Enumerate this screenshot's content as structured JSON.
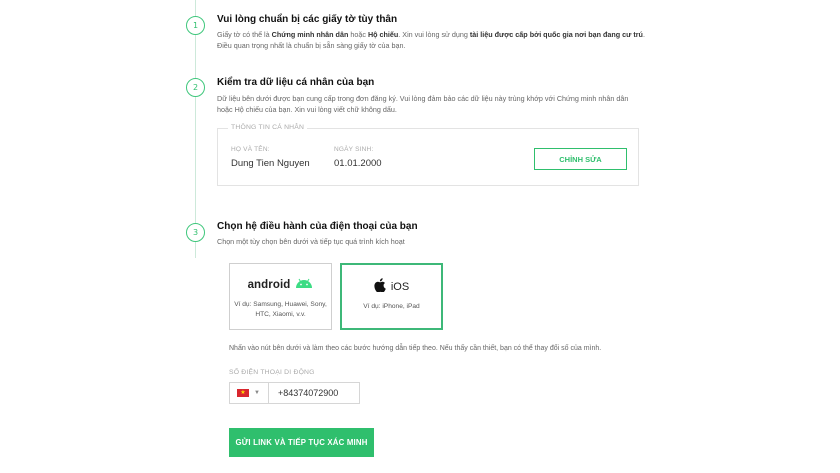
{
  "steps": [
    {
      "number": "1",
      "title": "Vui lòng chuẩn bị các giấy tờ tùy thân",
      "desc_parts": {
        "a": "Giấy tờ có thể là ",
        "b": "Chứng minh nhân dân",
        "c": " hoặc ",
        "d": "Hộ chiếu",
        "e": ". Xin vui lòng sử dụng ",
        "f": "tài liệu được cấp bởi quốc gia nơi bạn đang cư trú",
        "g": ". Điều quan trọng nhất là chuẩn bị sẵn sàng giấy tờ của bạn."
      }
    },
    {
      "number": "2",
      "title": "Kiểm tra dữ liệu cá nhân của bạn",
      "desc": "Dữ liệu bên dưới được bạn cung cấp trong đơn đăng ký. Vui lòng đảm bảo các dữ liệu này trùng khớp với Chứng minh nhân dân hoặc Hộ chiếu của bạn. Xin vui lòng viết chữ không dấu."
    },
    {
      "number": "3",
      "title": "Chọn hệ điều hành của điện thoại của bạn",
      "desc": "Chọn một tùy chọn bên dưới và tiếp tục quá trình kích hoạt"
    }
  ],
  "personal_info": {
    "section_title": "THÔNG TIN CÁ NHÂN",
    "name_label": "HỌ VÀ TÊN:",
    "name_value": "Dung Tien Nguyen",
    "dob_label": "NGÀY SINH:",
    "dob_value": "01.01.2000",
    "edit_label": "CHỈNH SỬA"
  },
  "os_options": {
    "android": {
      "name": "android",
      "example": "Ví dụ: Samsung, Huawei, Sony, HTC, Xiaomi, v.v.",
      "icon": "android-icon"
    },
    "ios": {
      "name": "iOS",
      "example": "Ví dụ: iPhone, iPad",
      "icon": "apple-icon",
      "selected": true
    }
  },
  "hint": "Nhấn vào nút bên dưới và làm theo các bước hướng dẫn tiếp theo. Nếu thấy cần thiết, bạn có thể thay đổi số của mình.",
  "phone": {
    "label": "SỐ ĐIỆN THOẠI DI ĐỘNG",
    "country_flag": "vietnam-flag-icon",
    "value": "+84374072900"
  },
  "submit_label": "GỬI LINK VÀ TIẾP TỤC XÁC MINH",
  "colors": {
    "accent": "#2fbf6d",
    "selected_border": "#3db878",
    "timeline": "#cde9da"
  }
}
